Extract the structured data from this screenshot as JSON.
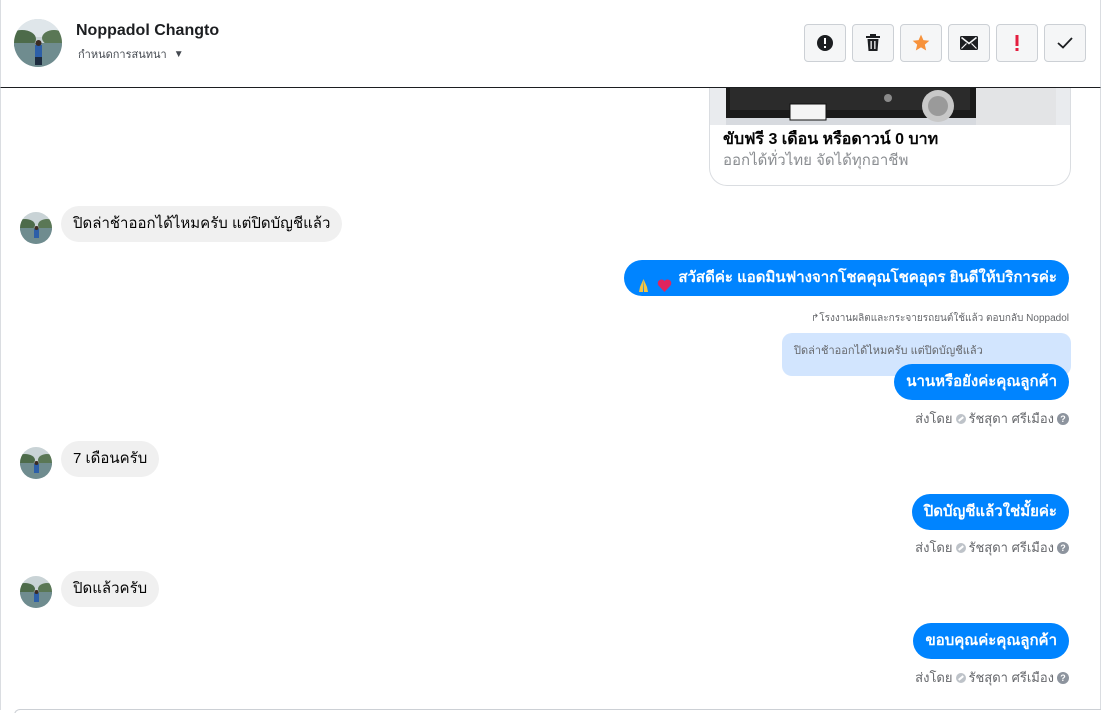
{
  "header": {
    "contact_name": "Noppadol Changto",
    "assign_label": "กำหนดการสนทนา"
  },
  "actions": [
    {
      "icon": "alert-circle-icon",
      "label": "Spam"
    },
    {
      "icon": "trash-icon",
      "label": "Delete"
    },
    {
      "icon": "star-icon",
      "label": "Star"
    },
    {
      "icon": "envelope-icon",
      "label": "Mark unread"
    },
    {
      "icon": "exclamation-icon",
      "label": "Follow up"
    },
    {
      "icon": "check-icon",
      "label": "Done"
    }
  ],
  "link_card": {
    "title": "ขับฟรี 3 เดือน หรือดาวน์ 0 บาท",
    "subtitle": "ออกได้ทั่วไทย จัดได้ทุกอาชีพ"
  },
  "messages": {
    "in_1": "ปิดล่าช้าออกได้ไหมครับ แต่ปิดบัญชีแล้ว",
    "out_1": "สวัสดีค่ะ แอดมินฟางจากโชคคุณโชคอุดร ยินดีให้บริการค่ะ",
    "reply_meta": "โรงงานผลิตและกระจายรถยนต์ใช้แล้ว ตอบกลับ Noppadol",
    "quoted_text": "ปิดล่าช้าออกได้ไหมครับ แต่ปิดบัญชีแล้ว",
    "out_2": "นานหรือยังค่ะคุณลูกค้า",
    "in_2": "7 เดือนครับ",
    "out_3": "ปิดบัญชีแล้วใช่มั้ยค่ะ",
    "in_3": "ปิดแล้วครับ",
    "out_4": "ขอบคุณค่ะคุณลูกค้า"
  },
  "sent_by": {
    "prefix": "ส่งโดย",
    "agent": "รัชสุดา ศรีเมือง"
  },
  "colors": {
    "outgoing_bubble": "#0084ff",
    "incoming_bubble": "#f0f0f0",
    "quote_bg": "#d2e5fe",
    "star": "#f7923b",
    "flag_red": "#e41e3f"
  }
}
